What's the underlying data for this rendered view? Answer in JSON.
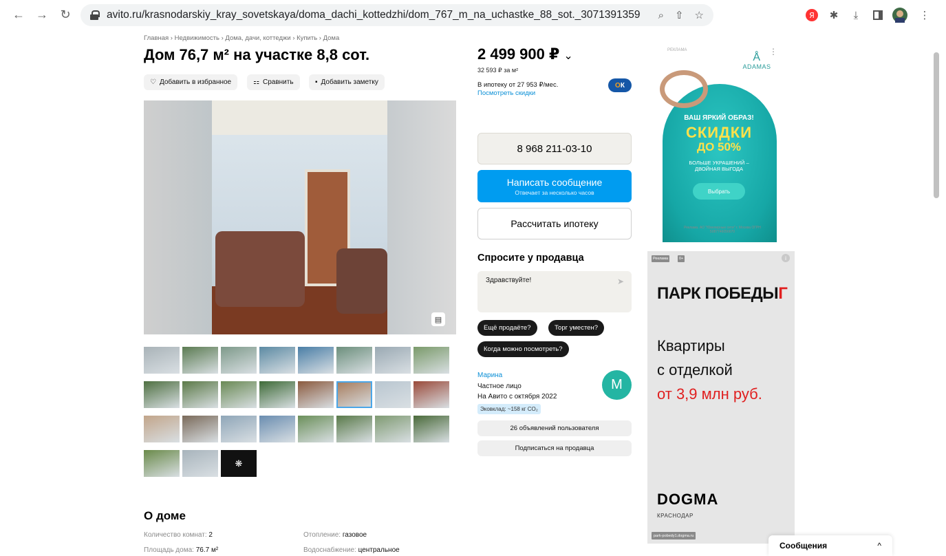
{
  "browser": {
    "url": "avito.ru/krasnodarskiy_kray_sovetskaya/doma_dachi_kottedzhi/dom_767_m_na_uchastke_88_sot._3071391359"
  },
  "listing": {
    "breadcrumbs": "Главная › Недвижимость › Дома, дачи, коттеджи › Купить › Дома",
    "title": "Дом 76,7 м² на участке 8,8 сот.",
    "actions": {
      "favorite": "Добавить в избранное",
      "compare": "Сравнить",
      "note": "Добавить заметку"
    }
  },
  "about": {
    "heading": "О доме",
    "params": [
      {
        "label": "Количество комнат: ",
        "value": "2"
      },
      {
        "label": "Площадь дома: ",
        "value": "76.7 м²"
      },
      {
        "label": "Отопление: ",
        "value": "газовое"
      },
      {
        "label": "Водоснабжение: ",
        "value": "центральное"
      }
    ]
  },
  "sidebar": {
    "price": "2 499 900 ₽",
    "price_chevron": "⌄",
    "price_per_m": "32 593 ₽ за м²",
    "mortgage": "В ипотеку от 27 953 ₽/мес.",
    "discounts_link": "Посмотреть скидки",
    "bank_logo": "О",
    "phone": "8 968 211-03-10",
    "message_title": "Написать сообщение",
    "message_sub": "Отвечает за несколько часов",
    "calc": "Рассчитать ипотеку",
    "ask_heading": "Спросите у продавца",
    "ask_text": "Здравствуйте!",
    "quick": [
      "Ещё продаёте?",
      "Торг уместен?",
      "Когда можно посмотреть?"
    ],
    "seller": {
      "name": "Марина",
      "type": "Частное лицо",
      "since": "На Авито с октября 2022",
      "eco": "Эковклад: ~158 кг CO₂",
      "avatar_letter": "М"
    },
    "listings_btn": "26 объявлений пользователя",
    "subscribe_btn": "Подписаться на продавца"
  },
  "ads": {
    "adamas": {
      "label": "РЕКЛАМА",
      "logo": "ADAMAS",
      "line1": "ВАШ ЯРКИЙ ОБРАЗ!",
      "line2": "СКИДКИ",
      "line3": "ДО 50%",
      "line4": "БОЛЬШЕ УКРАШЕНИЙ –",
      "line5": "ДВОЙНАЯ ВЫГОДА",
      "button": "Выбрать",
      "fine": "Реклама. АО \"Ювелирные сети\" г. Москва ОГРН 5087746056670"
    },
    "park": {
      "tag1": "Реклама",
      "tag2": "0+",
      "brand": "ПАРК ПОБЕДЫ",
      "brand_mark": "Г",
      "line1": "Квартиры",
      "line2": "с отделкой",
      "line3": "от 3,9 млн руб.",
      "dev": "DOGMA",
      "city": "КРАСНОДАР",
      "url": "park-pobedy1.dogma.ru"
    }
  },
  "messages_bar": {
    "label": "Сообщения",
    "chevron": "^"
  },
  "colors": {
    "accent": "#009cf0",
    "link": "#0a8fd6",
    "avatar": "#24b5a3"
  }
}
